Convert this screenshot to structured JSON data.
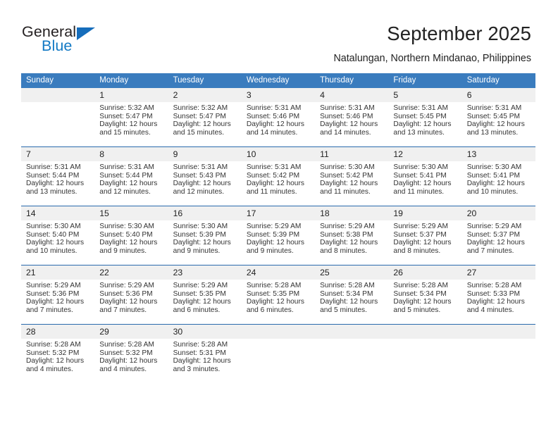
{
  "brand": {
    "name_part1": "General",
    "name_part2": "Blue",
    "triangle_icon": "triangle-logo-icon",
    "accent_color": "#166dbb"
  },
  "header": {
    "title": "September 2025",
    "subtitle": "Natalungan, Northern Mindanao, Philippines"
  },
  "calendar": {
    "header_bg": "#3a7cbe",
    "daynum_bg": "#f0f0f0",
    "separator_color": "#2a6aad",
    "weekdays": [
      "Sunday",
      "Monday",
      "Tuesday",
      "Wednesday",
      "Thursday",
      "Friday",
      "Saturday"
    ],
    "weeks": [
      [
        {
          "day": "",
          "sunrise": "",
          "sunset": "",
          "daylight1": "",
          "daylight2": ""
        },
        {
          "day": "1",
          "sunrise": "Sunrise: 5:32 AM",
          "sunset": "Sunset: 5:47 PM",
          "daylight1": "Daylight: 12 hours",
          "daylight2": "and 15 minutes."
        },
        {
          "day": "2",
          "sunrise": "Sunrise: 5:32 AM",
          "sunset": "Sunset: 5:47 PM",
          "daylight1": "Daylight: 12 hours",
          "daylight2": "and 15 minutes."
        },
        {
          "day": "3",
          "sunrise": "Sunrise: 5:31 AM",
          "sunset": "Sunset: 5:46 PM",
          "daylight1": "Daylight: 12 hours",
          "daylight2": "and 14 minutes."
        },
        {
          "day": "4",
          "sunrise": "Sunrise: 5:31 AM",
          "sunset": "Sunset: 5:46 PM",
          "daylight1": "Daylight: 12 hours",
          "daylight2": "and 14 minutes."
        },
        {
          "day": "5",
          "sunrise": "Sunrise: 5:31 AM",
          "sunset": "Sunset: 5:45 PM",
          "daylight1": "Daylight: 12 hours",
          "daylight2": "and 13 minutes."
        },
        {
          "day": "6",
          "sunrise": "Sunrise: 5:31 AM",
          "sunset": "Sunset: 5:45 PM",
          "daylight1": "Daylight: 12 hours",
          "daylight2": "and 13 minutes."
        }
      ],
      [
        {
          "day": "7",
          "sunrise": "Sunrise: 5:31 AM",
          "sunset": "Sunset: 5:44 PM",
          "daylight1": "Daylight: 12 hours",
          "daylight2": "and 13 minutes."
        },
        {
          "day": "8",
          "sunrise": "Sunrise: 5:31 AM",
          "sunset": "Sunset: 5:44 PM",
          "daylight1": "Daylight: 12 hours",
          "daylight2": "and 12 minutes."
        },
        {
          "day": "9",
          "sunrise": "Sunrise: 5:31 AM",
          "sunset": "Sunset: 5:43 PM",
          "daylight1": "Daylight: 12 hours",
          "daylight2": "and 12 minutes."
        },
        {
          "day": "10",
          "sunrise": "Sunrise: 5:31 AM",
          "sunset": "Sunset: 5:42 PM",
          "daylight1": "Daylight: 12 hours",
          "daylight2": "and 11 minutes."
        },
        {
          "day": "11",
          "sunrise": "Sunrise: 5:30 AM",
          "sunset": "Sunset: 5:42 PM",
          "daylight1": "Daylight: 12 hours",
          "daylight2": "and 11 minutes."
        },
        {
          "day": "12",
          "sunrise": "Sunrise: 5:30 AM",
          "sunset": "Sunset: 5:41 PM",
          "daylight1": "Daylight: 12 hours",
          "daylight2": "and 11 minutes."
        },
        {
          "day": "13",
          "sunrise": "Sunrise: 5:30 AM",
          "sunset": "Sunset: 5:41 PM",
          "daylight1": "Daylight: 12 hours",
          "daylight2": "and 10 minutes."
        }
      ],
      [
        {
          "day": "14",
          "sunrise": "Sunrise: 5:30 AM",
          "sunset": "Sunset: 5:40 PM",
          "daylight1": "Daylight: 12 hours",
          "daylight2": "and 10 minutes."
        },
        {
          "day": "15",
          "sunrise": "Sunrise: 5:30 AM",
          "sunset": "Sunset: 5:40 PM",
          "daylight1": "Daylight: 12 hours",
          "daylight2": "and 9 minutes."
        },
        {
          "day": "16",
          "sunrise": "Sunrise: 5:30 AM",
          "sunset": "Sunset: 5:39 PM",
          "daylight1": "Daylight: 12 hours",
          "daylight2": "and 9 minutes."
        },
        {
          "day": "17",
          "sunrise": "Sunrise: 5:29 AM",
          "sunset": "Sunset: 5:39 PM",
          "daylight1": "Daylight: 12 hours",
          "daylight2": "and 9 minutes."
        },
        {
          "day": "18",
          "sunrise": "Sunrise: 5:29 AM",
          "sunset": "Sunset: 5:38 PM",
          "daylight1": "Daylight: 12 hours",
          "daylight2": "and 8 minutes."
        },
        {
          "day": "19",
          "sunrise": "Sunrise: 5:29 AM",
          "sunset": "Sunset: 5:37 PM",
          "daylight1": "Daylight: 12 hours",
          "daylight2": "and 8 minutes."
        },
        {
          "day": "20",
          "sunrise": "Sunrise: 5:29 AM",
          "sunset": "Sunset: 5:37 PM",
          "daylight1": "Daylight: 12 hours",
          "daylight2": "and 7 minutes."
        }
      ],
      [
        {
          "day": "21",
          "sunrise": "Sunrise: 5:29 AM",
          "sunset": "Sunset: 5:36 PM",
          "daylight1": "Daylight: 12 hours",
          "daylight2": "and 7 minutes."
        },
        {
          "day": "22",
          "sunrise": "Sunrise: 5:29 AM",
          "sunset": "Sunset: 5:36 PM",
          "daylight1": "Daylight: 12 hours",
          "daylight2": "and 7 minutes."
        },
        {
          "day": "23",
          "sunrise": "Sunrise: 5:29 AM",
          "sunset": "Sunset: 5:35 PM",
          "daylight1": "Daylight: 12 hours",
          "daylight2": "and 6 minutes."
        },
        {
          "day": "24",
          "sunrise": "Sunrise: 5:28 AM",
          "sunset": "Sunset: 5:35 PM",
          "daylight1": "Daylight: 12 hours",
          "daylight2": "and 6 minutes."
        },
        {
          "day": "25",
          "sunrise": "Sunrise: 5:28 AM",
          "sunset": "Sunset: 5:34 PM",
          "daylight1": "Daylight: 12 hours",
          "daylight2": "and 5 minutes."
        },
        {
          "day": "26",
          "sunrise": "Sunrise: 5:28 AM",
          "sunset": "Sunset: 5:34 PM",
          "daylight1": "Daylight: 12 hours",
          "daylight2": "and 5 minutes."
        },
        {
          "day": "27",
          "sunrise": "Sunrise: 5:28 AM",
          "sunset": "Sunset: 5:33 PM",
          "daylight1": "Daylight: 12 hours",
          "daylight2": "and 4 minutes."
        }
      ],
      [
        {
          "day": "28",
          "sunrise": "Sunrise: 5:28 AM",
          "sunset": "Sunset: 5:32 PM",
          "daylight1": "Daylight: 12 hours",
          "daylight2": "and 4 minutes."
        },
        {
          "day": "29",
          "sunrise": "Sunrise: 5:28 AM",
          "sunset": "Sunset: 5:32 PM",
          "daylight1": "Daylight: 12 hours",
          "daylight2": "and 4 minutes."
        },
        {
          "day": "30",
          "sunrise": "Sunrise: 5:28 AM",
          "sunset": "Sunset: 5:31 PM",
          "daylight1": "Daylight: 12 hours",
          "daylight2": "and 3 minutes."
        },
        {
          "day": "",
          "sunrise": "",
          "sunset": "",
          "daylight1": "",
          "daylight2": ""
        },
        {
          "day": "",
          "sunrise": "",
          "sunset": "",
          "daylight1": "",
          "daylight2": ""
        },
        {
          "day": "",
          "sunrise": "",
          "sunset": "",
          "daylight1": "",
          "daylight2": ""
        },
        {
          "day": "",
          "sunrise": "",
          "sunset": "",
          "daylight1": "",
          "daylight2": ""
        }
      ]
    ]
  }
}
